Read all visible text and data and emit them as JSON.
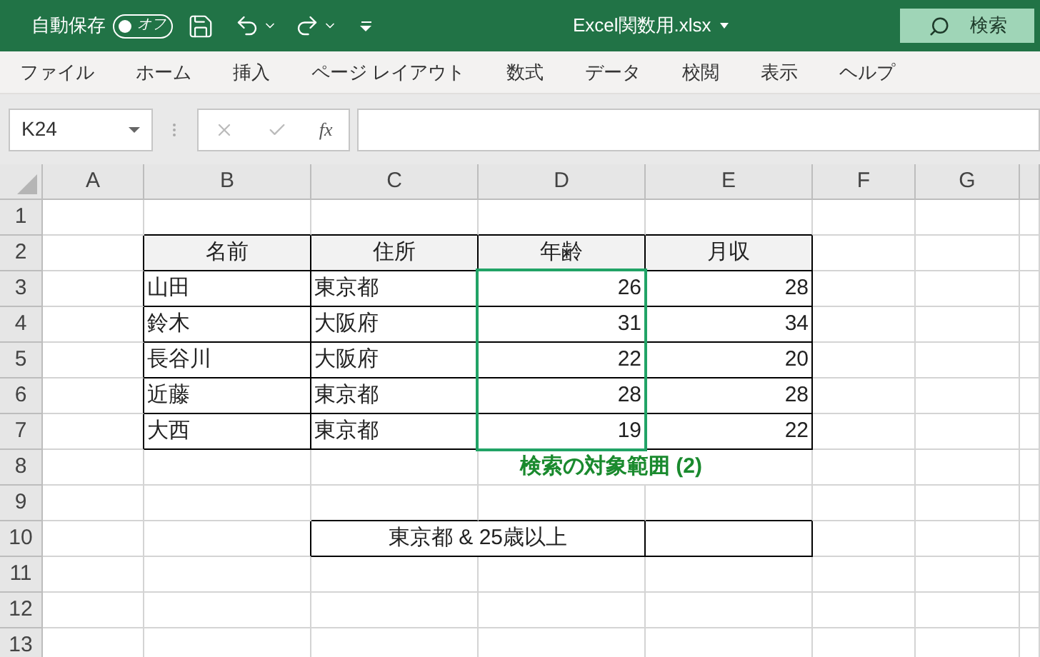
{
  "title_bar": {
    "autosave_label": "自動保存",
    "autosave_toggle": {
      "on": false,
      "label": "オフ"
    },
    "file_name": "Excel関数用.xlsx",
    "search_label": "検索"
  },
  "menu": [
    "ファイル",
    "ホーム",
    "挿入",
    "ページ レイアウト",
    "数式",
    "データ",
    "校閲",
    "表示",
    "ヘルプ"
  ],
  "formula_bar": {
    "name_box": "K24",
    "fx": "fx"
  },
  "sheet": {
    "columns": [
      "A",
      "B",
      "C",
      "D",
      "E",
      "F",
      "G"
    ],
    "row_numbers": [
      "1",
      "2",
      "3",
      "4",
      "5",
      "6",
      "7",
      "8",
      "9",
      "10",
      "11",
      "12",
      "13"
    ],
    "table": {
      "columns": [
        {
          "label": "名前",
          "highlighted": false
        },
        {
          "label": "住所",
          "highlighted": false
        },
        {
          "label": "年齢",
          "highlighted": true
        },
        {
          "label": "月収",
          "highlighted": false
        }
      ],
      "rows": [
        [
          "山田",
          "東京都",
          "26",
          "28"
        ],
        [
          "鈴木",
          "大阪府",
          "31",
          "34"
        ],
        [
          "長谷川",
          "大阪府",
          "22",
          "20"
        ],
        [
          "近藤",
          "東京都",
          "28",
          "28"
        ],
        [
          "大西",
          "東京都",
          "19",
          "22"
        ]
      ]
    },
    "note": "検索の対象範囲 (2)",
    "criteria": "東京都 & 25歳以上"
  }
}
